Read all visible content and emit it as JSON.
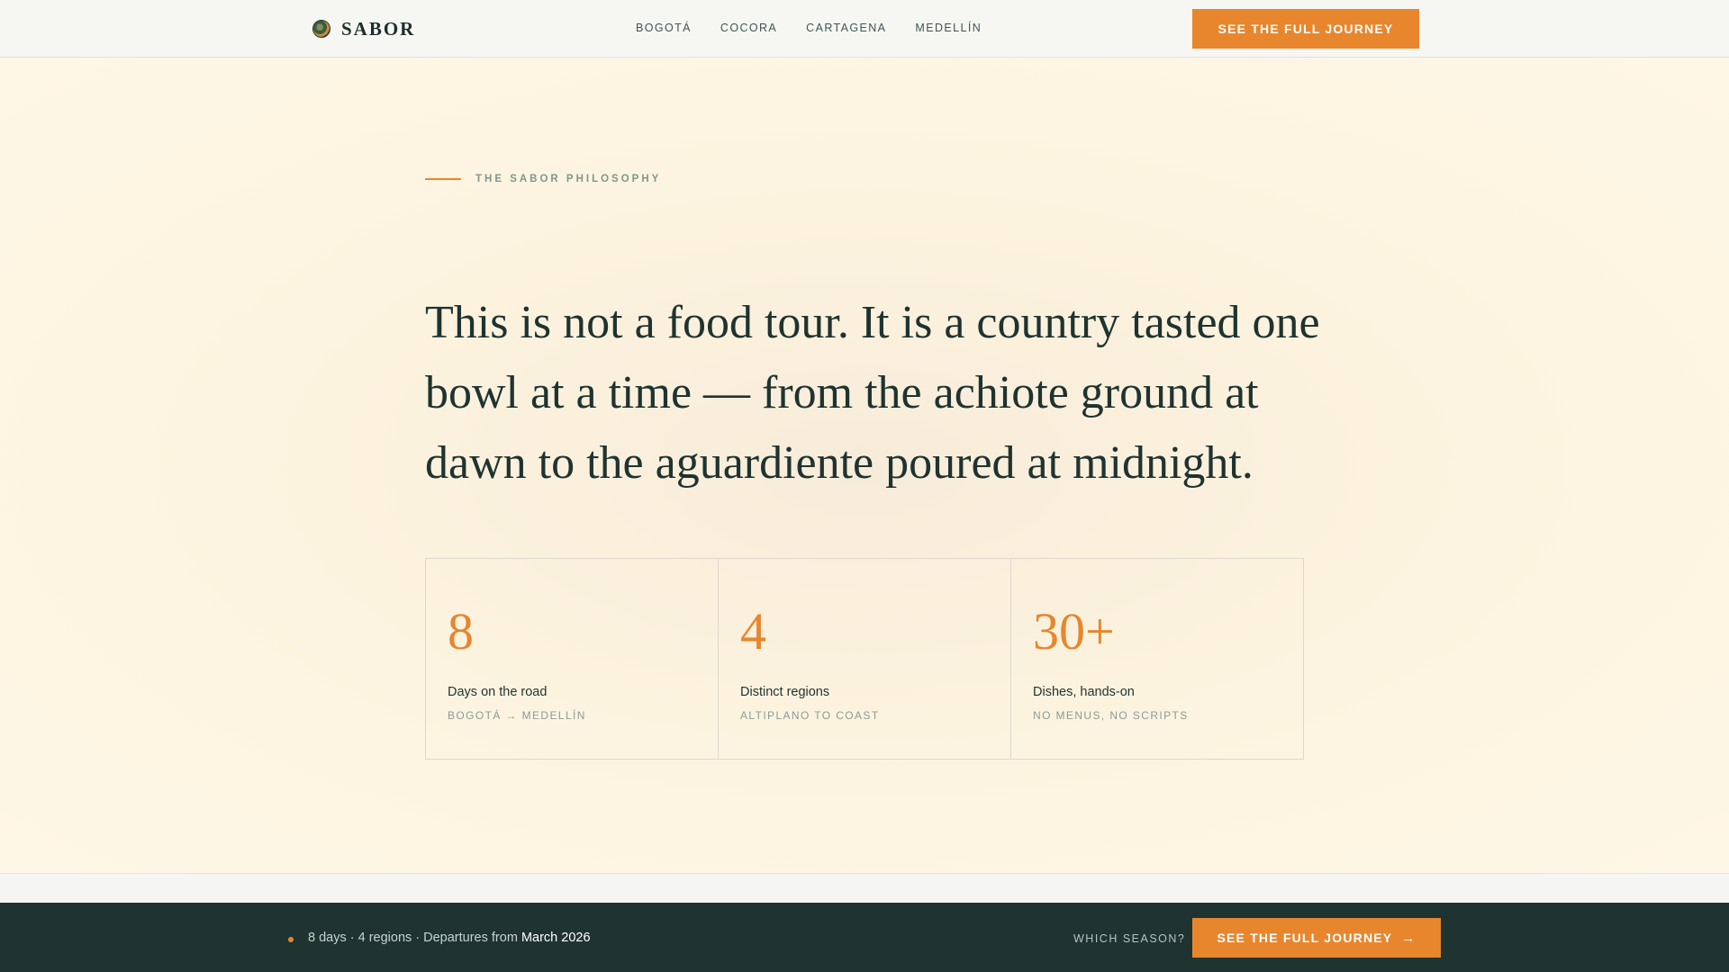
{
  "header": {
    "brand": "SABOR",
    "logo_icon": "globe-icon",
    "nav": [
      "BOGOTÁ",
      "COCORA",
      "CARTAGENA",
      "MEDELLÍN"
    ],
    "cta": "SEE THE FULL JOURNEY"
  },
  "hero": {
    "eyebrow": "THE SABOR PHILOSOPHY",
    "headline": "This is not a food tour. It is a country tasted one bowl at a time — from the achiote ground at dawn to the aguardiente poured at midnight.",
    "stats": [
      {
        "value": "8",
        "label": "Days on the road",
        "sub": "BOGOTÁ → MEDELLÍN"
      },
      {
        "value": "4",
        "label": "Distinct regions",
        "sub": "ALTIPLANO TO COAST"
      },
      {
        "value": "30+",
        "label": "Dishes, hands-on",
        "sub": "NO MENUS, NO SCRIPTS"
      }
    ]
  },
  "footer_bar": {
    "summary": "8 days · 4 regions · Departures from ",
    "highlight": "March 2026",
    "season_label": "WHICH SEASON?",
    "cta": "SEE THE FULL JOURNEY",
    "cta_icon": "arrow-right-icon"
  },
  "colors": {
    "accent": "#e8862e",
    "dark": "#1f3431",
    "text": "#1f3330"
  }
}
